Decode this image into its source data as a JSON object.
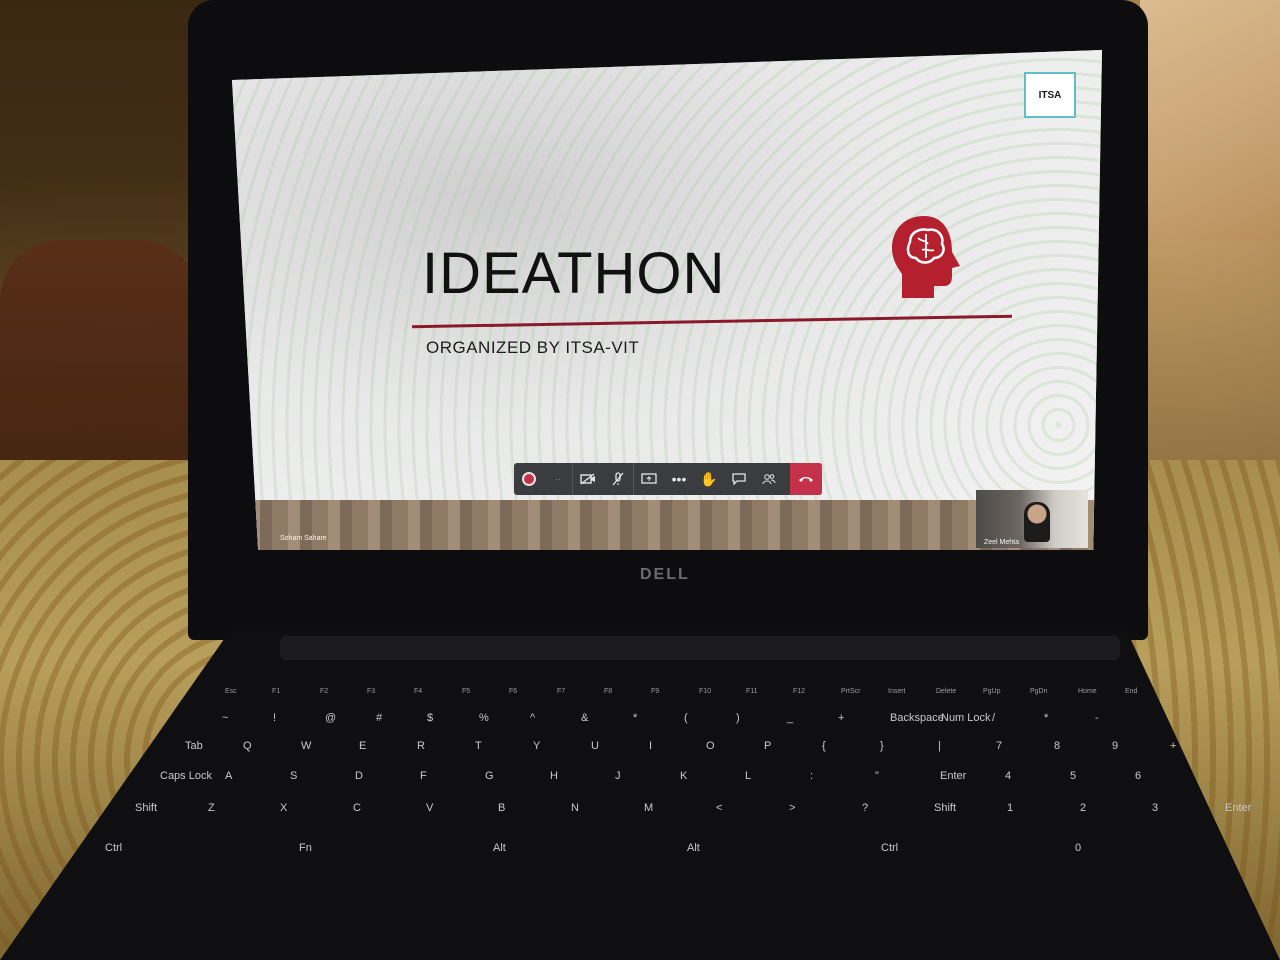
{
  "slide": {
    "logo": "ITSA",
    "title": "IDEATHON",
    "subtitle": "ORGANIZED BY ITSA-VIT"
  },
  "meeting": {
    "presenter_name": "Soham Sahare",
    "participant_name": "Zeel Mehta",
    "toolbar_icons": [
      "record-icon",
      "camera-off-icon",
      "mic-off-icon",
      "share-screen-icon",
      "more-icon",
      "raise-hand-icon",
      "chat-icon",
      "participants-icon",
      "hang-up-icon"
    ],
    "hangup_color": "#c4314b"
  },
  "laptop": {
    "brand": "DELL"
  },
  "keyboard": {
    "fn_row": [
      "Esc",
      "F1",
      "F2",
      "F3",
      "F4",
      "F5",
      "F6",
      "F7",
      "F8",
      "F9",
      "F10",
      "F11",
      "F12",
      "PrtScr",
      "Insert",
      "Delete",
      "PgUp",
      "PgDn",
      "Home",
      "End"
    ],
    "num_row": [
      "~",
      "!",
      "@",
      "#",
      "$",
      "%",
      "^",
      "&",
      "*",
      "(",
      ")",
      "_",
      "+",
      "Backspace",
      "Num Lock",
      "/",
      "*",
      "-"
    ],
    "row_q": [
      "Tab",
      "Q",
      "W",
      "E",
      "R",
      "T",
      "Y",
      "U",
      "I",
      "O",
      "P",
      "{",
      "}",
      "|",
      "7",
      "8",
      "9",
      "+"
    ],
    "row_a": [
      "Caps Lock",
      "A",
      "S",
      "D",
      "F",
      "G",
      "H",
      "J",
      "K",
      "L",
      ":",
      "\"",
      "Enter",
      "4",
      "5",
      "6"
    ],
    "row_z": [
      "Shift",
      "Z",
      "X",
      "C",
      "V",
      "B",
      "N",
      "M",
      "<",
      ">",
      "?",
      "Shift",
      "1",
      "2",
      "3",
      "Enter"
    ],
    "row_bottom": [
      "Ctrl",
      "Fn",
      "Alt",
      "Alt",
      "Ctrl",
      "0"
    ]
  }
}
